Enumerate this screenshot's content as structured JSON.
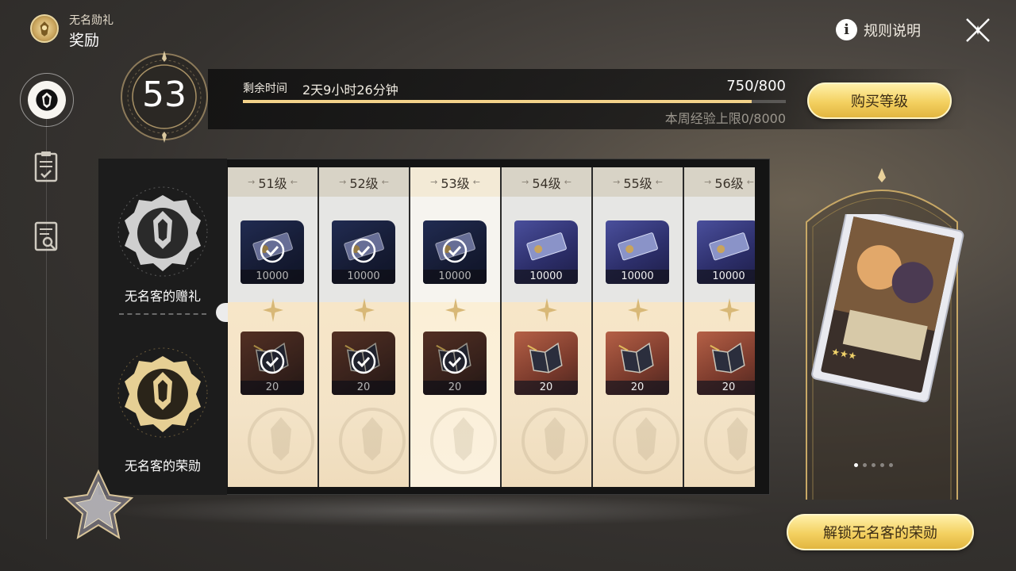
{
  "header": {
    "subtitle": "无名勋礼",
    "title": "奖励"
  },
  "rules_label": "规则说明",
  "level": {
    "current": "53",
    "remaining_label": "剩余时间",
    "remaining_value": "2天9小时26分钟",
    "exp_text": "750/800",
    "exp_progress": 0.9375,
    "weekly_limit_text": "本周经验上限0/8000"
  },
  "buy_level_label": "购买等级",
  "unlock_label": "解锁无名客的荣勋",
  "tracks": {
    "free_name": "无名客的赠礼",
    "premium_name": "无名客的荣勋"
  },
  "columns": [
    {
      "level": "51级",
      "free_qty": "10000",
      "premium_qty": "20",
      "claimed": true,
      "current": false
    },
    {
      "level": "52级",
      "free_qty": "10000",
      "premium_qty": "20",
      "claimed": true,
      "current": false
    },
    {
      "level": "53级",
      "free_qty": "10000",
      "premium_qty": "20",
      "claimed": true,
      "current": true
    },
    {
      "level": "54级",
      "free_qty": "10000",
      "premium_qty": "20",
      "claimed": false,
      "current": false
    },
    {
      "level": "55级",
      "free_qty": "10000",
      "premium_qty": "20",
      "claimed": false,
      "current": false
    },
    {
      "level": "56级",
      "free_qty": "10000",
      "premium_qty": "20",
      "claimed": false,
      "current": false
    }
  ],
  "showcase": {
    "page_count": 5,
    "active_page": 1
  },
  "icons": {
    "free_item": "credit-ticket-icon",
    "premium_item": "book-quill-icon",
    "claimed": "checkmark-icon",
    "rules": "info-icon",
    "close": "close-icon"
  },
  "colors": {
    "accent_gold": "#f3d060",
    "exp_fill": "#f3d28a",
    "board_dark": "#141414"
  }
}
